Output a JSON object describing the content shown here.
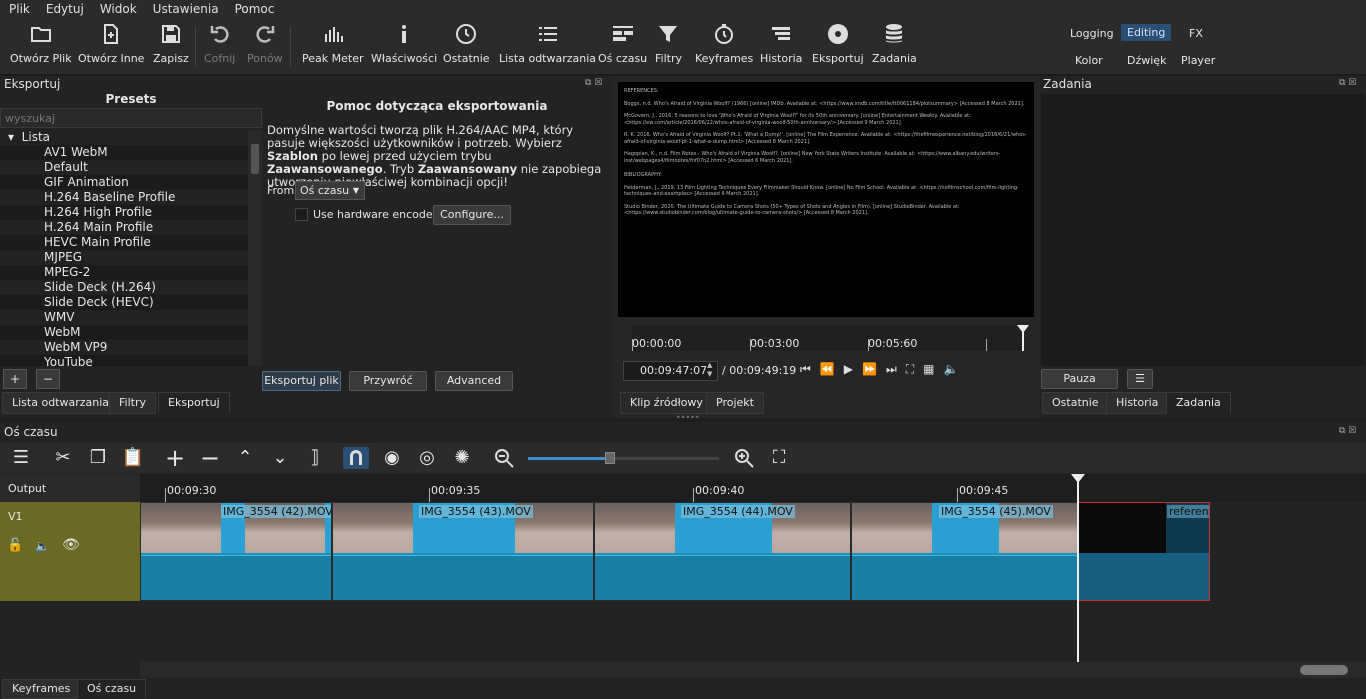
{
  "menu": [
    "Plik",
    "Edytuj",
    "Widok",
    "Ustawienia",
    "Pomoc"
  ],
  "toolbar": {
    "open_file": "Otwórz Plik",
    "open_other": "Otwórz Inne",
    "save": "Zapisz",
    "undo": "Cofnij",
    "redo": "Ponów",
    "peak_meter": "Peak Meter",
    "properties": "Właściwości",
    "recent": "Ostatnie",
    "playlist": "Lista odtwarzania",
    "timeline": "Oś czasu",
    "filters": "Filtry",
    "keyframes": "Keyframes",
    "history": "Historia",
    "export": "Eksportuj",
    "jobs": "Zadania"
  },
  "layouts": {
    "logging": "Logging",
    "editing": "Editing",
    "fx": "FX",
    "color": "Kolor",
    "audio": "Dźwięk",
    "player": "Player"
  },
  "export_panel": {
    "title": "Eksportuj",
    "presets_title": "Presets",
    "search_placeholder": "wyszukaj",
    "group": "Lista",
    "presets": [
      "AV1 WebM",
      "Default",
      "GIF Animation",
      "H.264 Baseline Profile",
      "H.264 High Profile",
      "H.264 Main Profile",
      "HEVC Main Profile",
      "MJPEG",
      "MPEG-2",
      "Slide Deck (H.264)",
      "Slide Deck (HEVC)",
      "WMV",
      "WebM",
      "WebM VP9",
      "YouTube"
    ],
    "help_title": "Pomoc dotycząca eksportowania",
    "help_1": "Domyślne wartości tworzą plik H.264/AAC MP4, który pasuje większości użytkowników i potrzeb. Wybierz ",
    "help_bold_1": "Szablon",
    "help_2": " po lewej przed użyciem trybu ",
    "help_bold_2": "Zaawansowanego",
    "help_3": ". Tryb ",
    "help_bold_3": "Zaawansowany",
    "help_4": " nie zapobiega utworzeniu niewłaściwej kombinacji opcji!",
    "from_label": "From",
    "from_value": "Oś czasu",
    "hw_encoder": "Use hardware encoder",
    "configure": "Configure...",
    "export_file": "Eksportuj plik",
    "reset": "Przywróć",
    "advanced": "Advanced",
    "add": "+",
    "remove": "−"
  },
  "left_tabs": [
    "Lista odtwarzania",
    "Filtry",
    "Eksportuj"
  ],
  "player": {
    "viewer_text": [
      "REFERENCES:",
      "Boggs, n.d. Who's Afraid of Virginia Woolf? (1966) [online] IMDb. Available at: <https://www.imdb.com/title/tt0061184/plotsummary> [Accessed 8 March 2021].",
      "McGovern, J., 2016. 5 reasons to love 'Who's Afraid of Virginia Woolf?' for its 50th anniversary. [online] Entertainment Weekly. Available at: <https://ew.com/article/2016/06/22/whos-afraid-of-virginia-woolf-50th-anniversary/> [Accessed 9 March 2021].",
      "R. K. 2016. Who's Afraid of Virginia Woolf? Pt.1: 'What a Dump!'. [online] The Film Experience. Available at: <https://thefilmexperience.net/blog/2016/6/21/whos-afraid-of-virginia-woolf-pt-1-what-a-dump.html> [Accessed 8 March 2021].",
      "Hagopian, K., n.d. Film Notes - Who's Afraid of Virginia Woolf?. [online] New York State Writers Institute. Available at: <https://www.albany.edu/writers-inst/webpages4/filmnotes/fnf07n2.html> [Accessed 6 March 2021].",
      "BIBLIOGRAPHY:",
      "Heiderman, J., 2019. 13 Film Lighting Techniques Every Filmmaker Should Know. [online] No Film School. Available at: <https://nofilmschool.com/film-lighting-techniques-and-examples> [Accessed 9 March 2021].",
      "Studio Binder, 2020. The Ultimate Guide to Camera Shots (50+ Types of Shots and Angles in Film). [online] StudioBinder. Available at: <https://www.studiobinder.com/blog/ultimate-guide-to-camera-shots/> [Accessed 8 March 2021]."
    ],
    "ruler": [
      "00:00:00",
      "00:03:00",
      "00:05:60"
    ],
    "position": "00:09:47:07",
    "duration": "/ 00:09:49:19"
  },
  "player_tabs": [
    "Klip źródłowy",
    "Projekt"
  ],
  "jobs_panel": {
    "title": "Zadania",
    "pause": "Pauza",
    "menu": "☰"
  },
  "right_tabs": [
    "Ostatnie",
    "Historia",
    "Zadania"
  ],
  "timeline": {
    "title": "Oś czasu",
    "output_label": "Output",
    "track": "V1",
    "ticks": [
      "00:09:30",
      "00:09:35",
      "00:09:40",
      "00:09:45"
    ],
    "clips": [
      "IMG_3554 (42).MOV",
      "IMG_3554 (43).MOV",
      "IMG_3554 (44).MOV",
      "IMG_3554 (45).MOV",
      "referenc"
    ]
  },
  "bottom_tabs": [
    "Keyframes",
    "Oś czasu"
  ],
  "colors": {
    "accent": "#2a4e74",
    "track_header": "#6b6a25",
    "clip": "#1f8fb8",
    "selected_clip_border": "#d0302f"
  }
}
